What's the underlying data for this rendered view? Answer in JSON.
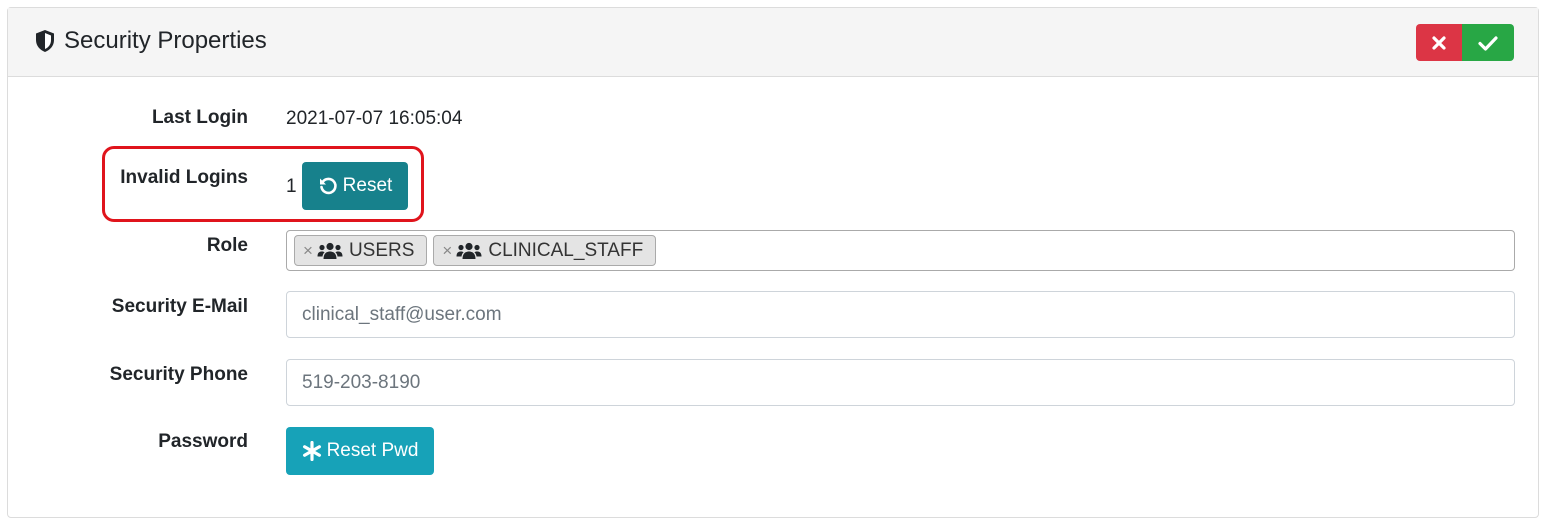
{
  "header": {
    "title": "Security Properties",
    "icon": "shield-icon",
    "cancel_icon": "close-icon",
    "confirm_icon": "check-icon"
  },
  "fields": {
    "last_login": {
      "label": "Last Login",
      "value": "2021-07-07 16:05:04"
    },
    "invalid_logins": {
      "label": "Invalid Logins",
      "value": "1",
      "button_label": "Reset",
      "button_icon": "undo-icon"
    },
    "role": {
      "label": "Role",
      "chips": [
        {
          "remove": "×",
          "icon": "users-icon",
          "label": "USERS"
        },
        {
          "remove": "×",
          "icon": "users-icon",
          "label": "CLINICAL_STAFF"
        }
      ]
    },
    "security_email": {
      "label": "Security E-Mail",
      "value": "clinical_staff@user.com"
    },
    "security_phone": {
      "label": "Security Phone",
      "value": "519-203-8190"
    },
    "password": {
      "label": "Password",
      "button_label": "Reset Pwd",
      "button_icon": "asterisk-icon"
    }
  },
  "colors": {
    "cancel": "#dc3545",
    "confirm": "#28a745",
    "reset_button": "#17818c",
    "reset_pwd_button": "#17a2b8",
    "highlight": "#e0141c"
  }
}
